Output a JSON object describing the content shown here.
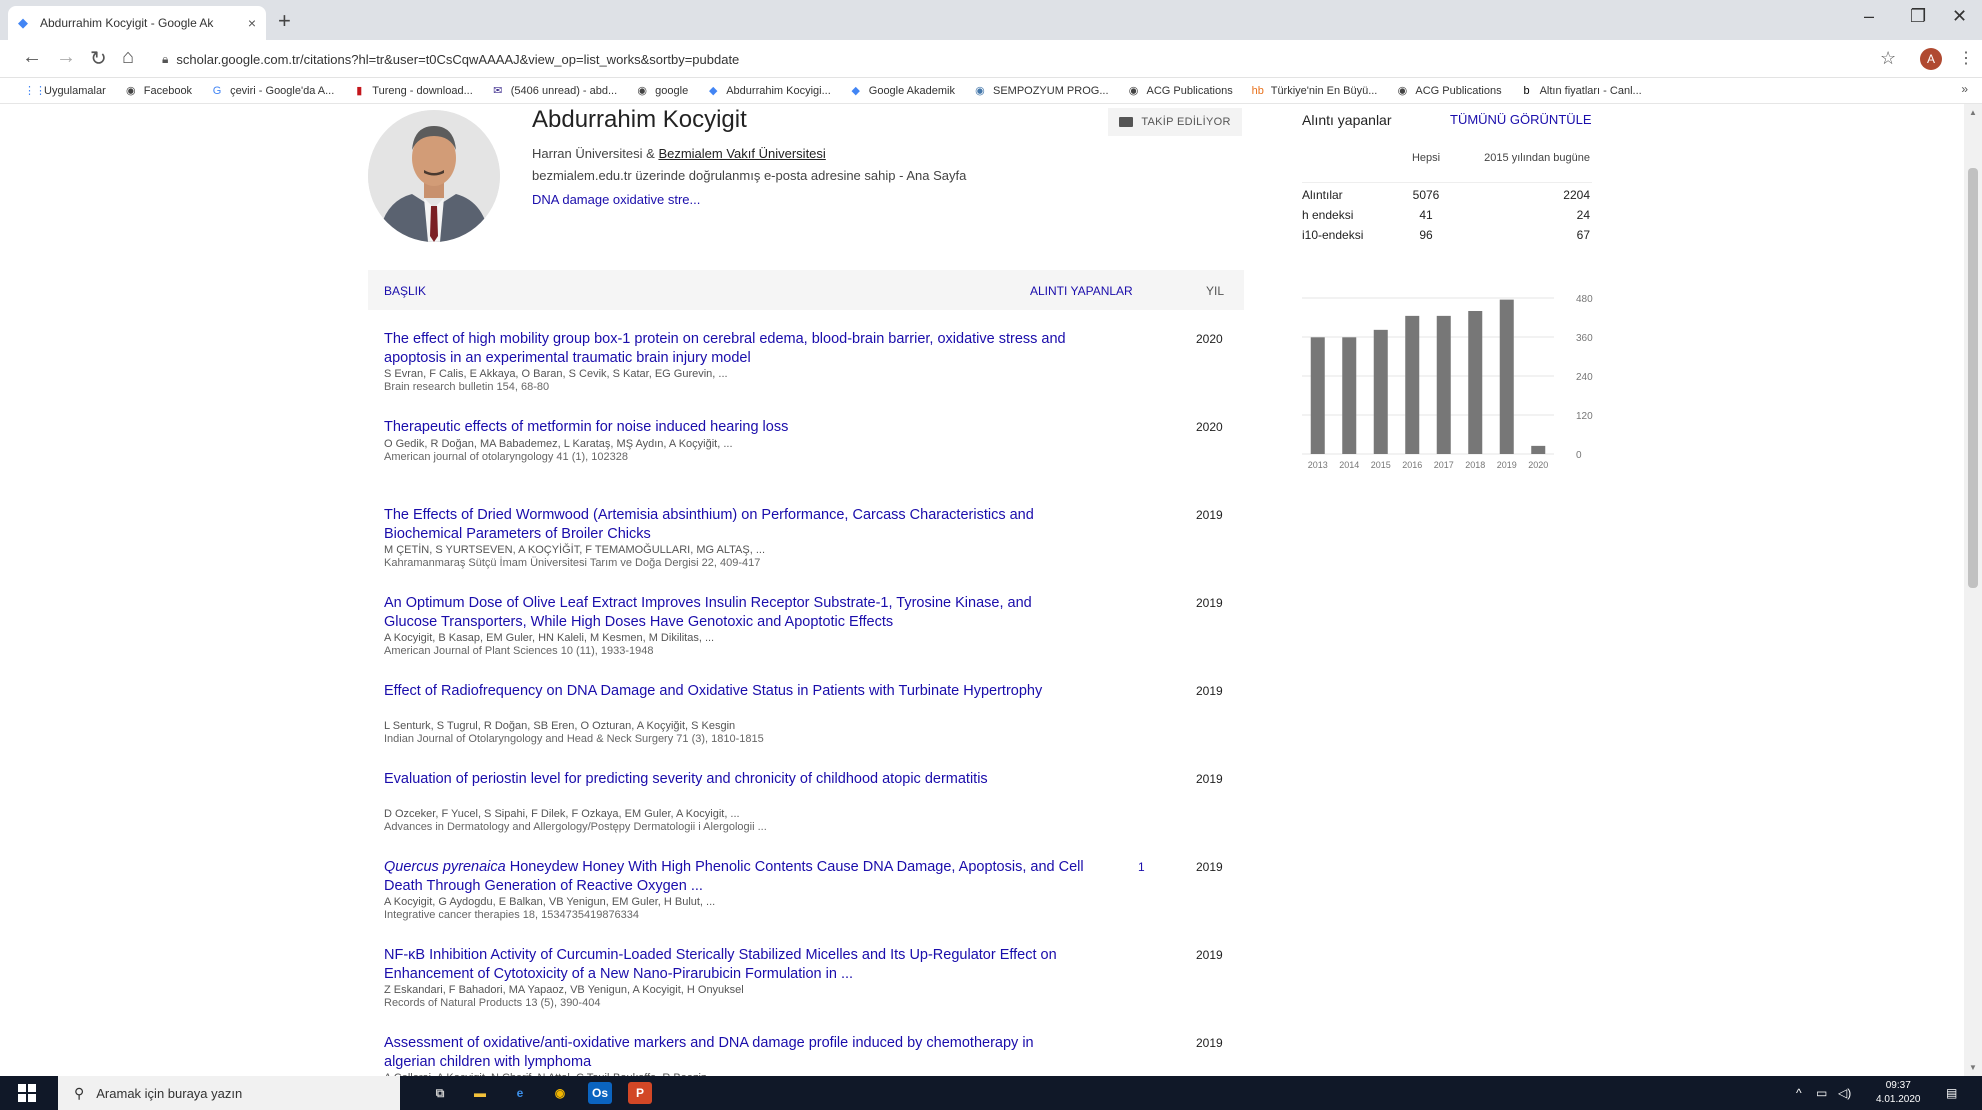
{
  "browser": {
    "tab_title": "Abdurrahim Kocyigit - Google Ak",
    "tab_close": "×",
    "new_tab": "+",
    "url": "scholar.google.com.tr/citations?hl=tr&user=t0CsCqwAAAAJ&view_op=list_works&sortby=pubdate",
    "window": {
      "minimize": "–",
      "restore": "❐",
      "close": "✕"
    },
    "profile_initial": "A",
    "bookmarks": [
      {
        "label": "Uygulamalar",
        "icon": "apps-grid-icon",
        "glyph": "⋮⋮",
        "color": "#4285f4"
      },
      {
        "label": "Facebook",
        "icon": "globe-icon",
        "glyph": "◉",
        "color": "#444"
      },
      {
        "label": "çeviri - Google'da A...",
        "icon": "google-icon",
        "glyph": "G",
        "color": "#4285f4"
      },
      {
        "label": "Tureng - download...",
        "icon": "tureng-icon",
        "glyph": "▮",
        "color": "#c4161c"
      },
      {
        "label": "(5406 unread) - abd...",
        "icon": "mail-icon",
        "glyph": "✉",
        "color": "#3b2a8c"
      },
      {
        "label": "google",
        "icon": "globe-icon",
        "glyph": "◉",
        "color": "#444"
      },
      {
        "label": "Abdurrahim Kocyigi...",
        "icon": "scholar-icon",
        "glyph": "◆",
        "color": "#4285f4"
      },
      {
        "label": "Google Akademik",
        "icon": "scholar-icon",
        "glyph": "◆",
        "color": "#4285f4"
      },
      {
        "label": "SEMPOZYUM PROG...",
        "icon": "globe-icon",
        "glyph": "◉",
        "color": "#4477aa"
      },
      {
        "label": "ACG Publications",
        "icon": "globe-icon",
        "glyph": "◉",
        "color": "#444"
      },
      {
        "label": "Türkiye'nin En Büyü...",
        "icon": "news-icon",
        "glyph": "hb",
        "color": "#e8711c"
      },
      {
        "label": "ACG Publications",
        "icon": "globe-icon",
        "glyph": "◉",
        "color": "#444"
      },
      {
        "label": "Altın fiyatları - Canl...",
        "icon": "bold-b-icon",
        "glyph": "b",
        "color": "#000"
      }
    ],
    "bookmarks_more": "»"
  },
  "profile": {
    "name": "Abdurrahim Kocyigit",
    "affil_prefix": "Harran Üniversitesi & ",
    "affil_link": "Bezmialem Vakıf Üniversitesi",
    "verified_text": "bezmialem.edu.tr üzerinde doğrulanmış e-posta adresine sahip - ",
    "homepage": "Ana Sayfa",
    "interests": "DNA damage oxidative stre...",
    "follow_label": "TAKİP EDİLİYOR"
  },
  "table": {
    "col_title": "BAŞLIK",
    "col_cited": "ALINTI YAPANLAR",
    "col_year": "YIL",
    "articles": [
      {
        "title": "The effect of high mobility group box-1 protein on cerebral edema, blood-brain barrier, oxidative stress and apoptosis in an experimental traumatic brain injury model",
        "title_italic": "",
        "authors": "S Evran, F Calis, E Akkaya, O Baran, S Cevik, S Katar, EG Gurevin, ...",
        "venue": "Brain research bulletin 154, 68-80",
        "cited": "",
        "year": "2020"
      },
      {
        "title": "Therapeutic effects of metformin for noise induced hearing loss",
        "title_italic": "",
        "authors": "O Gedik, R Doğan, MA Babademez, L Karataş, MŞ Aydın, A Koçyiğit, ...",
        "venue": "American journal of otolaryngology 41 (1), 102328",
        "cited": "",
        "year": "2020"
      },
      {
        "title": "The Effects of Dried Wormwood (Artemisia absinthium) on Performance, Carcass Characteristics and Biochemical Parameters of Broiler Chicks",
        "title_italic": "",
        "authors": "M ÇETİN, S YURTSEVEN, A KOÇYİĞİT, F TEMAMOĞULLARI, MG ALTAŞ, ...",
        "venue": "Kahramanmaraş Sütçü İmam Üniversitesi Tarım ve Doğa Dergisi 22, 409-417",
        "cited": "",
        "year": "2019"
      },
      {
        "title": "An Optimum Dose of Olive Leaf Extract Improves Insulin Receptor Substrate-1, Tyrosine Kinase, and Glucose Transporters, While High Doses Have Genotoxic and Apoptotic Effects",
        "title_italic": "",
        "authors": "A Kocyigit, B Kasap, EM Guler, HN Kaleli, M Kesmen, M Dikilitas, ...",
        "venue": "American Journal of Plant Sciences 10 (11), 1933-1948",
        "cited": "",
        "year": "2019"
      },
      {
        "title": "Effect of Radiofrequency on DNA Damage and Oxidative Status in Patients with Turbinate Hypertrophy",
        "title_italic": "",
        "authors": "L Senturk, S Tugrul, R Doğan, SB Eren, O Ozturan, A Koçyiğit, S Kesgin",
        "venue": "Indian Journal of Otolaryngology and Head & Neck Surgery 71 (3), 1810-1815",
        "cited": "",
        "year": "2019"
      },
      {
        "title": "Evaluation of periostin level for predicting severity and chronicity of childhood atopic dermatitis",
        "title_italic": "",
        "authors": "D Ozceker, F Yucel, S Sipahi, F Dilek, F Ozkaya, EM Guler, A Kocyigit, ...",
        "venue": "Advances in Dermatology and Allergology/Postępy Dermatologii i Alergologii ...",
        "cited": "",
        "year": "2019"
      },
      {
        "title": " Honeydew Honey With High Phenolic Contents Cause DNA Damage, Apoptosis, and Cell Death Through Generation of Reactive Oxygen ...",
        "title_italic": "Quercus pyrenaica",
        "authors": "A Kocyigit, G Aydogdu, E Balkan, VB Yenigun, EM Guler, H Bulut, ...",
        "venue": "Integrative cancer therapies 18, 1534735419876334",
        "cited": "1",
        "year": "2019"
      },
      {
        "title": "NF-κB Inhibition Activity of Curcumin-Loaded Sterically Stabilized Micelles and Its Up-Regulator Effect on Enhancement of Cytotoxicity of a New Nano-Pirarubicin Formulation in ...",
        "title_italic": "",
        "authors": "Z Eskandari, F Bahadori, MA Yapaoz, VB Yenigun, A Kocyigit, H Onyuksel",
        "venue": "Records of Natural Products 13 (5), 390-404",
        "cited": "",
        "year": "2019"
      },
      {
        "title": "Assessment of oxidative/anti-oxidative markers and DNA damage profile induced by chemotherapy in algerian children with lymphoma",
        "title_italic": "",
        "authors": "A Cellerai, A Kocyigit, N Cherif, N Attal, C Touil-Boukoffa, R Baaziz ...",
        "venue": "",
        "cited": "",
        "year": "2019"
      }
    ]
  },
  "citations_panel": {
    "title": "Alıntı yapanlar",
    "view_all": "TÜMÜNÜ GÖRÜNTÜLE",
    "col_all": "Hepsi",
    "col_since": "2015 yılından bugüne",
    "rows": [
      {
        "label": "Alıntılar",
        "all": "5076",
        "since": "2204"
      },
      {
        "label": "h endeksi",
        "all": "41",
        "since": "24"
      },
      {
        "label": "i10-endeksi",
        "all": "96",
        "since": "67"
      }
    ]
  },
  "chart_data": {
    "type": "bar",
    "categories": [
      "2013",
      "2014",
      "2015",
      "2016",
      "2017",
      "2018",
      "2019",
      "2020"
    ],
    "values": [
      359,
      359,
      382,
      425,
      425,
      440,
      475,
      25
    ],
    "yticks": [
      "480",
      "360",
      "240",
      "120",
      "0"
    ],
    "ylim": [
      0,
      480
    ],
    "bar_color": "#777777",
    "grid": true
  },
  "taskbar": {
    "search_placeholder": "Aramak için buraya yazın",
    "time": "09:37",
    "date": "4.01.2020",
    "apps": [
      {
        "name": "task-view-icon",
        "glyph": "⧉",
        "bg": "#101828",
        "fg": "#ccc"
      },
      {
        "name": "file-explorer-icon",
        "glyph": "▬",
        "bg": "#101828",
        "fg": "#f3c13a"
      },
      {
        "name": "edge-icon",
        "glyph": "e",
        "bg": "#101828",
        "fg": "#3c8ee8"
      },
      {
        "name": "chrome-icon",
        "glyph": "◉",
        "bg": "#101828",
        "fg": "#f2b600"
      },
      {
        "name": "outlook-icon",
        "glyph": "Os",
        "bg": "#0b64c0",
        "fg": "#fff"
      },
      {
        "name": "powerpoint-icon",
        "glyph": "P",
        "bg": "#d24726",
        "fg": "#fff"
      }
    ]
  }
}
